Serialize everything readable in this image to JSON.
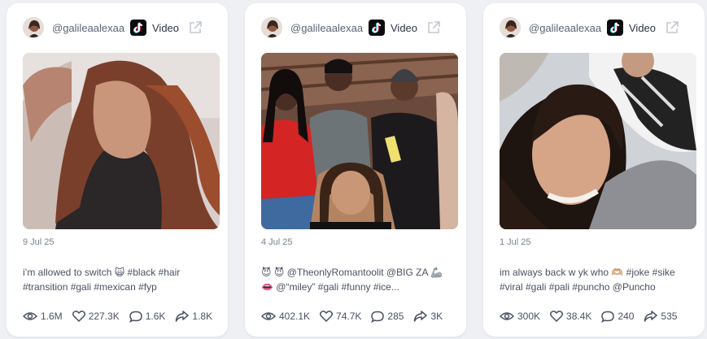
{
  "cards": [
    {
      "username": "@galileaalexaa",
      "platform_icon": "tiktok-icon",
      "type_label": "Video",
      "date": "9 Jul 25",
      "caption_lines": [
        "i’m allowed to switch 🙀 #black #hair",
        "#transition #gali #mexican #fyp"
      ],
      "stats": {
        "views": "1.6M",
        "likes": "227.3K",
        "comments": "1.6K",
        "shares": "1.8K"
      }
    },
    {
      "username": "@galileaalexaa",
      "platform_icon": "tiktok-icon",
      "type_label": "Video",
      "date": "4 Jul 25",
      "caption_lines": [
        "😈 😈 @TheonlyRomantoolit @BIG ZA 🦾",
        "👄 @“miley” #gali #funny #ice..."
      ],
      "stats": {
        "views": "402.1K",
        "likes": "74.7K",
        "comments": "285",
        "shares": "3K"
      }
    },
    {
      "username": "@galileaalexaa",
      "platform_icon": "tiktok-icon",
      "type_label": "Video",
      "date": "1 Jul 25",
      "caption_lines": [
        "im always back w yk who 🫶🏼 #joke #sike",
        "#viral #gali #pali #puncho @Puncho"
      ],
      "stats": {
        "views": "300K",
        "likes": "38.4K",
        "comments": "240",
        "shares": "535"
      }
    }
  ],
  "colors": {
    "background": "#eef0f4",
    "card": "#ffffff",
    "text": "#4a5161",
    "muted": "#7a8190"
  }
}
